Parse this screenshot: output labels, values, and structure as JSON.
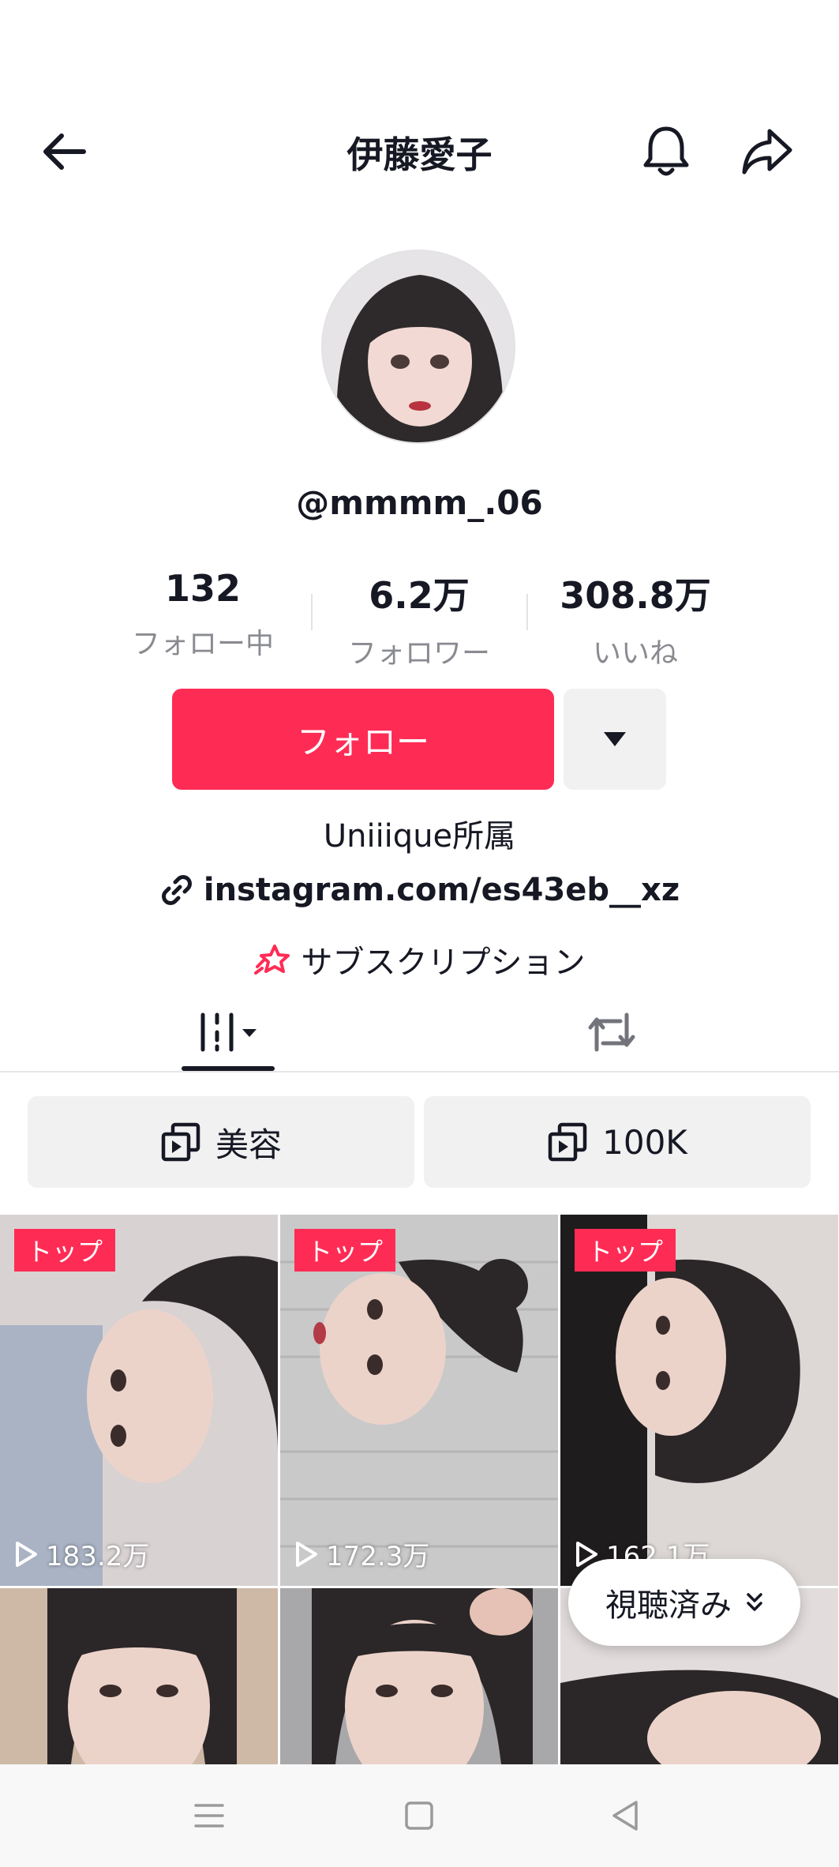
{
  "header": {
    "title": "伊藤愛子",
    "back_icon": "arrow-left-icon",
    "bell_icon": "bell-icon",
    "share_icon": "share-icon"
  },
  "profile": {
    "handle": "@mmmm_.06",
    "stats": [
      {
        "value": "132",
        "label": "フォロー中"
      },
      {
        "value": "6.2万",
        "label": "フォロワー"
      },
      {
        "value": "308.8万",
        "label": "いいね"
      }
    ],
    "follow_label": "フォロー",
    "bio": "Uniiique所属",
    "link": "instagram.com/es43eb__xz",
    "subscription": "サブスクリプション"
  },
  "playlists": [
    {
      "label": "美容"
    },
    {
      "label": "100K"
    }
  ],
  "videos": [
    {
      "badge": "トップ",
      "views": "183.2万"
    },
    {
      "badge": "トップ",
      "views": "172.3万"
    },
    {
      "badge": "トップ",
      "views": "162.1万"
    },
    {
      "badge": "",
      "views": ""
    },
    {
      "badge": "",
      "views": ""
    },
    {
      "badge": "",
      "views": ""
    }
  ],
  "watched_label": "視聴済み",
  "colors": {
    "accent": "#fe2c55",
    "text": "#161823",
    "muted": "#8a8b91"
  }
}
